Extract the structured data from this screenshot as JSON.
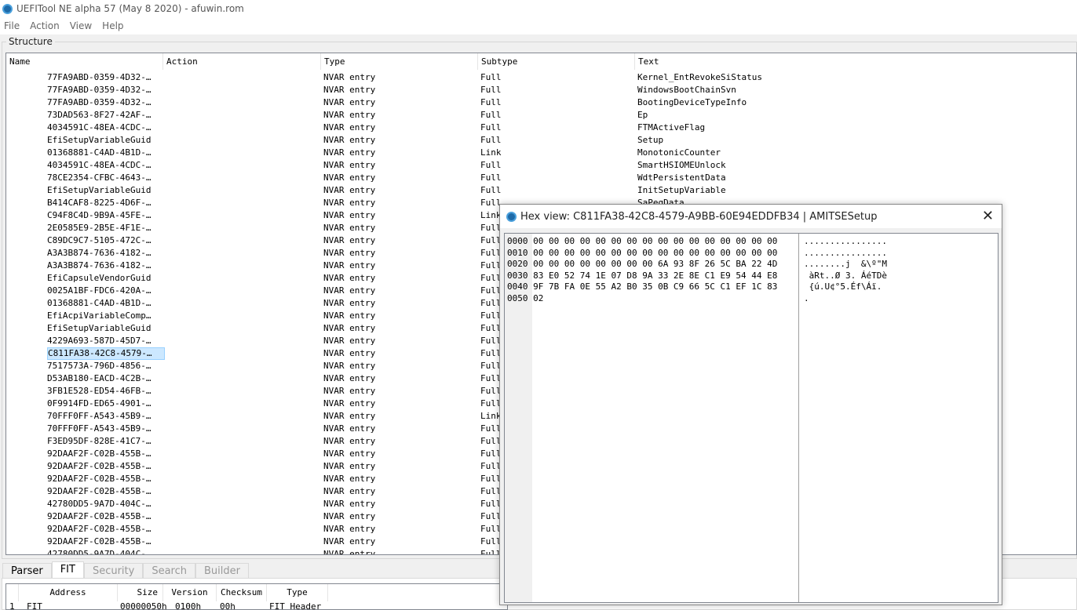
{
  "window": {
    "title": "UEFITool NE alpha 57 (May  8 2020) - afuwin.rom",
    "icon": "gear-app-icon"
  },
  "menu": [
    "File",
    "Action",
    "View",
    "Help"
  ],
  "structure": {
    "label": "Structure",
    "columns": [
      "Name",
      "Action",
      "Type",
      "Subtype",
      "Text"
    ],
    "selected_index": 22,
    "rows": [
      [
        "77FA9ABD-0359-4D32-…",
        "",
        "NVAR entry",
        "Full",
        "Kernel_EntRevokeSiStatus"
      ],
      [
        "77FA9ABD-0359-4D32-…",
        "",
        "NVAR entry",
        "Full",
        "WindowsBootChainSvn"
      ],
      [
        "77FA9ABD-0359-4D32-…",
        "",
        "NVAR entry",
        "Full",
        "BootingDeviceTypeInfo"
      ],
      [
        "73DAD563-8F27-42AF-…",
        "",
        "NVAR entry",
        "Full",
        "Ep"
      ],
      [
        "4034591C-48EA-4CDC-…",
        "",
        "NVAR entry",
        "Full",
        "FTMActiveFlag"
      ],
      [
        "EfiSetupVariableGuid",
        "",
        "NVAR entry",
        "Full",
        "Setup"
      ],
      [
        "01368881-C4AD-4B1D-…",
        "",
        "NVAR entry",
        "Link",
        "MonotonicCounter"
      ],
      [
        "4034591C-48EA-4CDC-…",
        "",
        "NVAR entry",
        "Full",
        "SmartHSIOMEUnlock"
      ],
      [
        "78CE2354-CFBC-4643-…",
        "",
        "NVAR entry",
        "Full",
        "WdtPersistentData"
      ],
      [
        "EfiSetupVariableGuid",
        "",
        "NVAR entry",
        "Full",
        "InitSetupVariable"
      ],
      [
        "B414CAF8-8225-4D6F-…",
        "",
        "NVAR entry",
        "Full",
        "SaPegData"
      ],
      [
        "C94F8C4D-9B9A-45FE-…",
        "",
        "NVAR entry",
        "Link",
        ""
      ],
      [
        "2E0585E9-2B5E-4F1E-…",
        "",
        "NVAR entry",
        "Full",
        ""
      ],
      [
        "C89DC9C7-5105-472C-…",
        "",
        "NVAR entry",
        "Full",
        ""
      ],
      [
        "A3A3B874-7636-4182-…",
        "",
        "NVAR entry",
        "Full",
        ""
      ],
      [
        "A3A3B874-7636-4182-…",
        "",
        "NVAR entry",
        "Full",
        ""
      ],
      [
        "EfiCapsuleVendorGuid",
        "",
        "NVAR entry",
        "Full",
        ""
      ],
      [
        "0025A1BF-FDC6-420A-…",
        "",
        "NVAR entry",
        "Full",
        ""
      ],
      [
        "01368881-C4AD-4B1D-…",
        "",
        "NVAR entry",
        "Full",
        ""
      ],
      [
        "EfiAcpiVariableComp…",
        "",
        "NVAR entry",
        "Full",
        ""
      ],
      [
        "EfiSetupVariableGuid",
        "",
        "NVAR entry",
        "Full",
        ""
      ],
      [
        "4229A693-587D-45D7-…",
        "",
        "NVAR entry",
        "Full",
        ""
      ],
      [
        "C811FA38-42C8-4579-…",
        "",
        "NVAR entry",
        "Full",
        ""
      ],
      [
        "7517573A-796D-4856-…",
        "",
        "NVAR entry",
        "Full",
        ""
      ],
      [
        "D53AB180-EACD-4C2B-…",
        "",
        "NVAR entry",
        "Full",
        ""
      ],
      [
        "3FB1E528-ED54-46FB-…",
        "",
        "NVAR entry",
        "Full",
        ""
      ],
      [
        "0F9914FD-ED65-4901-…",
        "",
        "NVAR entry",
        "Full",
        ""
      ],
      [
        "70FFF0FF-A543-45B9-…",
        "",
        "NVAR entry",
        "Link",
        ""
      ],
      [
        "70FFF0FF-A543-45B9-…",
        "",
        "NVAR entry",
        "Full",
        ""
      ],
      [
        "F3ED95DF-828E-41C7-…",
        "",
        "NVAR entry",
        "Full",
        ""
      ],
      [
        "92DAAF2F-C02B-455B-…",
        "",
        "NVAR entry",
        "Full",
        ""
      ],
      [
        "92DAAF2F-C02B-455B-…",
        "",
        "NVAR entry",
        "Full",
        ""
      ],
      [
        "92DAAF2F-C02B-455B-…",
        "",
        "NVAR entry",
        "Full",
        ""
      ],
      [
        "92DAAF2F-C02B-455B-…",
        "",
        "NVAR entry",
        "Full",
        ""
      ],
      [
        "42780DD5-9A7D-404C-…",
        "",
        "NVAR entry",
        "Full",
        ""
      ],
      [
        "92DAAF2F-C02B-455B-…",
        "",
        "NVAR entry",
        "Full",
        ""
      ],
      [
        "92DAAF2F-C02B-455B-…",
        "",
        "NVAR entry",
        "Full",
        ""
      ],
      [
        "92DAAF2F-C02B-455B-…",
        "",
        "NVAR entry",
        "Full",
        ""
      ],
      [
        "42780DD5-9A7D-404C-…",
        "",
        "NVAR entry",
        "Full",
        ""
      ]
    ]
  },
  "bottom_tabs": {
    "items": [
      "Parser",
      "FIT",
      "Security",
      "Search",
      "Builder"
    ],
    "active": "FIT"
  },
  "fit_table": {
    "columns": [
      "",
      "Address",
      "Size",
      "Version",
      "Checksum",
      "Type"
    ],
    "rows": [
      [
        "1",
        "FIT",
        "00000050h",
        "0100h",
        "00h",
        "FIT Header"
      ]
    ]
  },
  "hex_dialog": {
    "title": "Hex view: C811FA38-42C8-4579-A9BB-60E94EDDFB34 | AMITSESetup",
    "close": "✕",
    "lines": [
      {
        "offset": "0000",
        "hex": "00 00 00 00 00 00 00 00 00 00 00 00 00 00 00 00",
        "ascii": "................"
      },
      {
        "offset": "0010",
        "hex": "00 00 00 00 00 00 00 00 00 00 00 00 00 00 00 00",
        "ascii": "................"
      },
      {
        "offset": "0020",
        "hex": "00 00 00 00 00 00 00 00 6A 93 8F 26 5C BA 22 4D",
        "ascii": "........j  &\\º\"M"
      },
      {
        "offset": "0030",
        "hex": "83 E0 52 74 1E 07 D8 9A 33 2E 8E C1 E9 54 44 E8",
        "ascii": " àRt..Ø 3. ÁéTDè"
      },
      {
        "offset": "0040",
        "hex": "9F 7B FA 0E 55 A2 B0 35 0B C9 66 5C C1 EF 1C 83",
        "ascii": " {ú.U¢°5.Éf\\Áï. "
      },
      {
        "offset": "0050",
        "hex": "02",
        "ascii": "."
      }
    ]
  }
}
